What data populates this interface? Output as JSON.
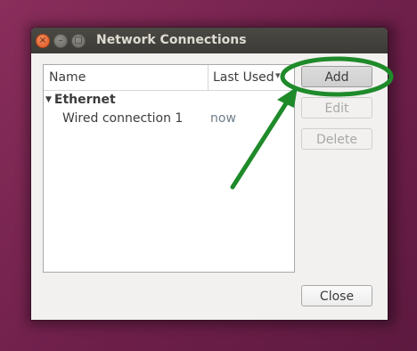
{
  "window": {
    "title": "Network Connections",
    "buttons": {
      "close": "×",
      "minimize": "–",
      "maximize": "□"
    }
  },
  "list": {
    "columns": {
      "name": "Name",
      "last_used": "Last Used",
      "sort_indicator": "▾"
    },
    "groups": [
      {
        "label": "Ethernet",
        "connections": [
          {
            "name": "Wired connection 1",
            "last_used": "now"
          }
        ]
      }
    ]
  },
  "actions": {
    "add": "Add",
    "edit": "Edit",
    "delete": "Delete",
    "close": "Close"
  },
  "annotation": {
    "color": "#1f8a2a"
  }
}
